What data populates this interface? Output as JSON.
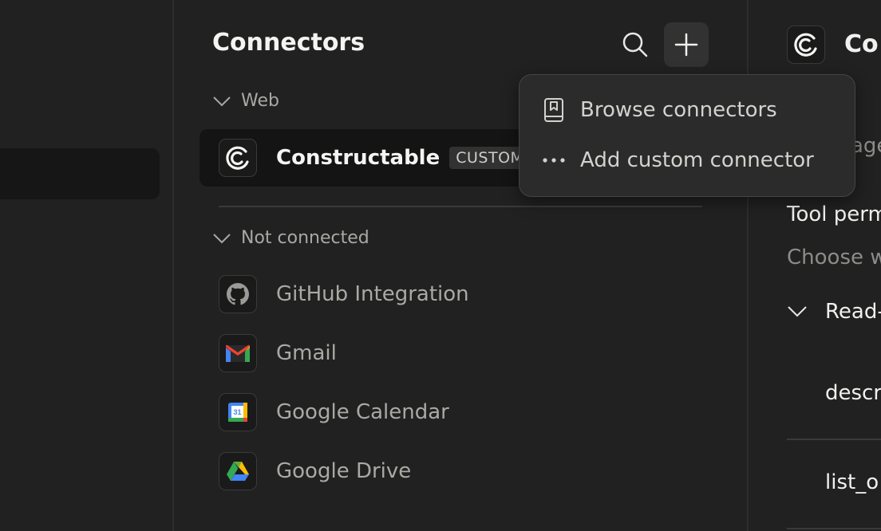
{
  "middle": {
    "title": "Connectors",
    "sections": {
      "web": {
        "label": "Web"
      },
      "not_connected": {
        "label": "Not connected"
      }
    },
    "connected": [
      {
        "name": "Constructable",
        "badge": "CUSTOM",
        "icon": "constructable-logo"
      }
    ],
    "not_connected_items": [
      {
        "name": "GitHub Integration",
        "icon": "github-logo"
      },
      {
        "name": "Gmail",
        "icon": "gmail-logo"
      },
      {
        "name": "Google Calendar",
        "icon": "google-calendar-logo",
        "icon_text": "31"
      },
      {
        "name": "Google Drive",
        "icon": "google-drive-logo"
      }
    ]
  },
  "dropdown": {
    "items": [
      {
        "label": "Browse connectors",
        "icon": "book-icon"
      },
      {
        "label": "Add custom connector",
        "icon": "more-dots-icon"
      }
    ]
  },
  "right": {
    "title_partial": "Co",
    "partial_1": "age",
    "tool_permissions_partial": "Tool perm",
    "choose_partial": "Choose w",
    "read_partial": "Read-",
    "descr_partial": "descr",
    "list_partial": "list_o"
  },
  "colors": {
    "background": "#212121",
    "selected_row": "#141414",
    "menu_bg": "#2b2b2b",
    "gmail_red": "#ea4335",
    "google_blue": "#4285f4",
    "google_green": "#34a853",
    "google_yellow": "#fbbc04"
  }
}
